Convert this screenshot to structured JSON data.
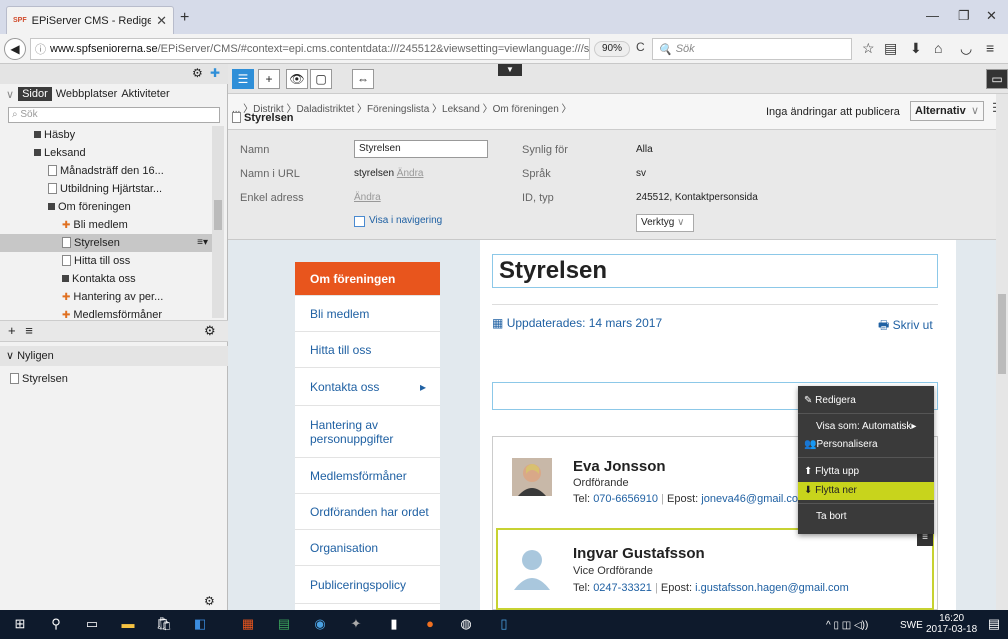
{
  "browser": {
    "tab_title": "EPiServer CMS - Redigera",
    "tab_favicon": "SPF",
    "url_host": "www.spfseniorerna.se",
    "url_path": "/EPiServer/CMS/#context=epi.cms.contentdata:///245512&viewsetting=viewlanguage:///sv",
    "zoom": "90%",
    "search_placeholder": "Sök"
  },
  "left_panel": {
    "tabs": [
      "Sidor",
      "Webbplatser",
      "Aktiviteter"
    ],
    "search_placeholder": "Sök",
    "tree": [
      {
        "label": "Häsby",
        "icon": "box",
        "indent": 1
      },
      {
        "label": "Leksand",
        "icon": "box",
        "indent": 1
      },
      {
        "label": "Månadsträff den 16...",
        "icon": "page",
        "indent": 2
      },
      {
        "label": "Utbildning Hjärtstar...",
        "icon": "page",
        "indent": 2
      },
      {
        "label": "Om föreningen",
        "icon": "box",
        "indent": 2
      },
      {
        "label": "Bli medlem",
        "icon": "pin",
        "indent": 3
      },
      {
        "label": "Styrelsen",
        "icon": "page",
        "indent": 3,
        "selected": true
      },
      {
        "label": "Hitta till oss",
        "icon": "page",
        "indent": 3
      },
      {
        "label": "Kontakta oss",
        "icon": "box",
        "indent": 3
      },
      {
        "label": "Hantering av per...",
        "icon": "pin",
        "indent": 3
      },
      {
        "label": "Medlemsförmåner",
        "icon": "pin",
        "indent": 3
      }
    ],
    "recent_header": "Nyligen",
    "recent_items": [
      "Styrelsen"
    ]
  },
  "header": {
    "breadcrumb": "... 〉Distrikt 〉Daladistriktet 〉Föreningslista 〉Leksand 〉Om föreningen 〉",
    "current_page": "Styrelsen",
    "status": "Inga ändringar att publicera",
    "publish_button": "Alternativ"
  },
  "properties": {
    "name_label": "Namn",
    "name_value": "Styrelsen",
    "url_label": "Namn i URL",
    "url_value": "styrelsen",
    "change_link": "Ändra",
    "simple_label": "Enkel adress",
    "simple_link": "Ändra",
    "show_in_nav": "Visa i navigering",
    "visible_label": "Synlig för",
    "visible_value": "Alla",
    "lang_label": "Språk",
    "lang_value": "sv",
    "id_label": "ID, typ",
    "id_value": "245512, Kontaktpersonsida",
    "tools_button": "Verktyg"
  },
  "sidenav": [
    "Om föreningen",
    "Bli medlem",
    "Hitta till oss",
    "Kontakta oss",
    "Hantering av personuppgifter",
    "Medlemsförmåner",
    "Ordföranden har ordet",
    "Organisation",
    "Publiceringspolicy"
  ],
  "page": {
    "title": "Styrelsen",
    "updated": "Uppdaterades: 14 mars 2017",
    "print": "Skriv ut"
  },
  "contacts": [
    {
      "name": "Eva Jonsson",
      "role": "Ordförande",
      "tel_label": "Tel:",
      "tel": "070-6656910",
      "email_label": "Epost:",
      "email": "joneva46@gmail.com"
    },
    {
      "name": "Ingvar Gustafsson",
      "role": "Vice Ordförande",
      "tel_label": "Tel:",
      "tel": "0247-33321",
      "email_label": "Epost:",
      "email": "i.gustafsson.hagen@gmail.com"
    }
  ],
  "context_menu": {
    "edit": "Redigera",
    "view_as": "Visa som: Automatisk",
    "personalize": "Personalisera",
    "move_up": "Flytta upp",
    "move_down": "Flytta ner",
    "delete": "Ta bort"
  },
  "taskbar": {
    "lang": "SWE",
    "time": "16:20",
    "date": "2017-03-18"
  },
  "colors": {
    "accent_orange": "#e8551d",
    "link_blue": "#2061a3",
    "highlight_yellow": "#c8d41c"
  }
}
